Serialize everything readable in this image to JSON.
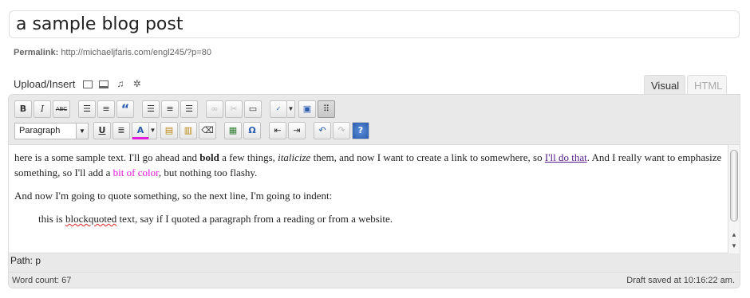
{
  "post": {
    "title": "a sample blog post",
    "permalink_label": "Permalink:",
    "permalink_url": "http://michaeljfaris.com/engl245/?p=80"
  },
  "media": {
    "label": "Upload/Insert",
    "icons": [
      "image-icon",
      "video-icon",
      "audio-icon",
      "media-gear-icon"
    ]
  },
  "tabs": {
    "visual": "Visual",
    "html": "HTML"
  },
  "toolbar": {
    "bold": "B",
    "italic": "I",
    "strike": "ABC",
    "blockquote": "“",
    "format_select": "Paragraph",
    "underline": "U",
    "forecolor": "A",
    "special_char": "Ω",
    "help": "?"
  },
  "content": {
    "p1_a": "here is a some sample text. I'll go ahead and ",
    "p1_bold": "bold",
    "p1_b": " a few things, ",
    "p1_italic": "italicize",
    "p1_c": " them, and now I want to create a link to somewhere, so ",
    "p1_link": "I'll do that",
    "p1_d": ". And I really want to emphasize something, so I'll add a ",
    "p1_color": "bit of color",
    "p1_e": ", but nothing too flashy.",
    "p2": "And now I'm going to quote something, so the next line, I'm going to indent:",
    "q_a": "this is ",
    "q_spell": "blockquoted",
    "q_b": " text, say if I quoted a paragraph from a reading or from a website."
  },
  "status": {
    "path": "Path: p",
    "word_count": "Word count: 67",
    "draft": "Draft saved at 10:16:22 am."
  },
  "colors": {
    "link": "#551a8b",
    "highlight": "#e31adb"
  }
}
